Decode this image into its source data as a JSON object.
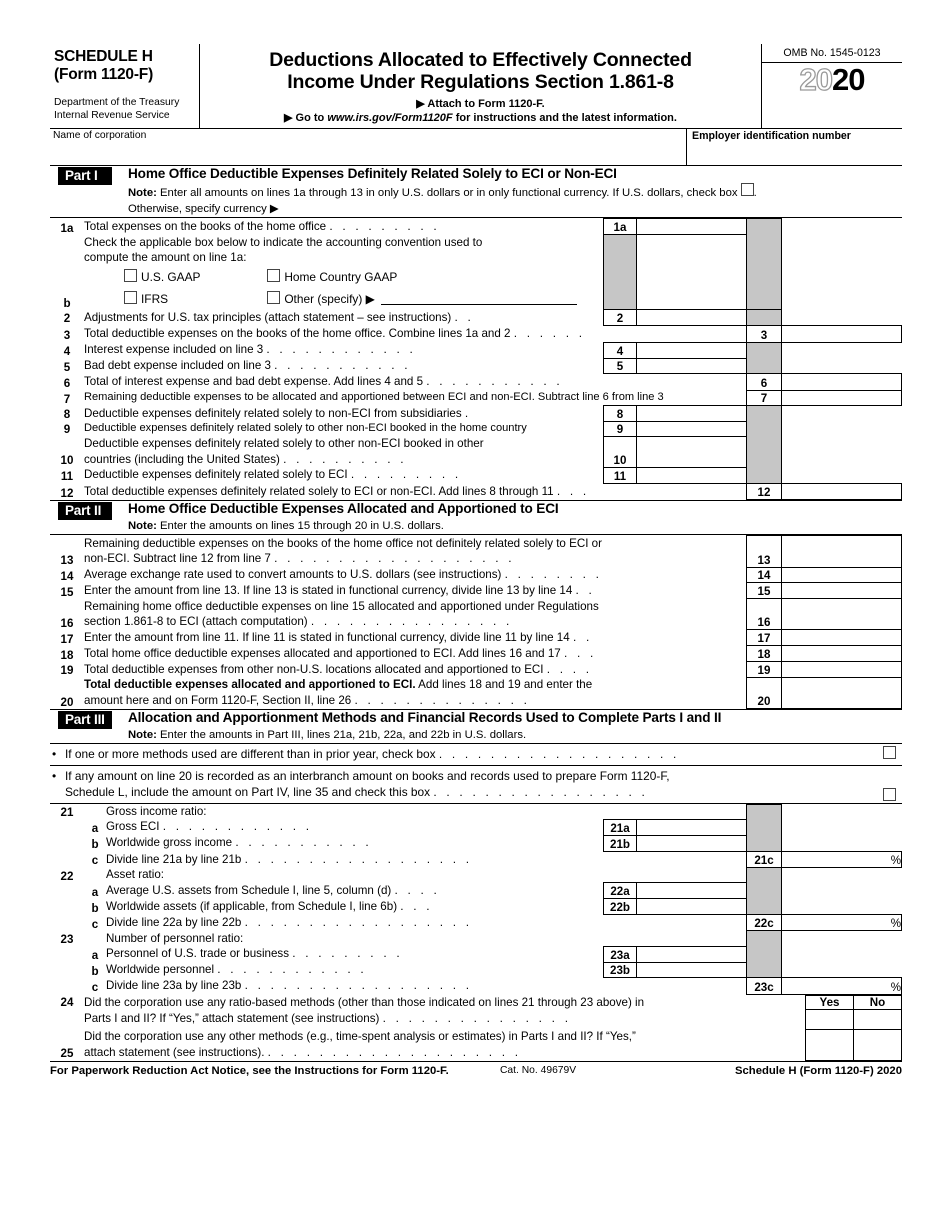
{
  "header": {
    "schedule_line1": "SCHEDULE H",
    "schedule_line2": "(Form 1120-F)",
    "dept_line1": "Department of the Treasury",
    "dept_line2": "Internal Revenue Service",
    "title_line1": "Deductions Allocated to Effectively Connected",
    "title_line2": "Income Under Regulations Section 1.861-8",
    "attach": "▶ Attach to Form 1120-F.",
    "goto_prefix": "▶ Go to ",
    "goto_url": "www.irs.gov/Form1120F",
    "goto_suffix": " for instructions and the latest information.",
    "omb": "OMB No. 1545-0123",
    "year_ghost": "20",
    "year_solid": "20"
  },
  "identity": {
    "name_label": "Name of corporation",
    "ein_label": "Employer identification number"
  },
  "part1": {
    "badge": "Part I",
    "heading": "Home Office Deductible Expenses Definitely Related Solely to ECI or Non-ECI",
    "note_bold": "Note:",
    "note_text": " Enter all amounts on lines 1a through 13 in only U.S. dollars or in only functional currency. If U.S. dollars, check box ",
    "note_tail": ".",
    "note_line2": "Otherwise, specify currency ▶",
    "rows": [
      {
        "num": "1a",
        "text": "Total expenses on the books of the home office",
        "dots": ". . . . . . . . .",
        "box": "1a",
        "col": "inner"
      },
      {
        "num": "b",
        "text": "Check the applicable box below to indicate the accounting convention used to",
        "text2": "compute the amount on line 1a:",
        "col": "none"
      },
      {
        "num": "2",
        "text": "Adjustments for U.S. tax principles (attach statement – see instructions)",
        "dots": ". .",
        "box": "2",
        "col": "inner"
      },
      {
        "num": "3",
        "text": "Total deductible expenses on the books of the home office. Combine lines 1a and 2",
        "dots": ". . . . . .",
        "box": "3",
        "col": "outer"
      },
      {
        "num": "4",
        "text": "Interest expense included on line 3",
        "dots": ". . . . . . . . . . . .",
        "box": "4",
        "col": "inner"
      },
      {
        "num": "5",
        "text": "Bad debt expense included on line 3",
        "dots": ". . . . . . . . . . .",
        "box": "5",
        "col": "inner"
      },
      {
        "num": "6",
        "text": "Total of interest expense and bad debt expense. Add lines 4 and 5",
        "dots": ". . . . . . . . . . .",
        "box": "6",
        "col": "outer"
      },
      {
        "num": "7",
        "text": "Remaining deductible expenses to be allocated and apportioned between ECI and non-ECI. Subtract line 6 from line 3",
        "dots": "",
        "box": "7",
        "col": "outer"
      },
      {
        "num": "8",
        "text": "Deductible expenses definitely related solely to non-ECI from subsidiaries",
        "dots": ".",
        "box": "8",
        "col": "inner"
      },
      {
        "num": "9",
        "text": "Deductible expenses definitely related solely to other non-ECI booked in the home country",
        "dots": "",
        "box": "9",
        "col": "inner"
      },
      {
        "num": "10",
        "text": "Deductible expenses definitely related solely to other non-ECI booked in other",
        "text2": "countries (including the United States)",
        "dots2": ". . . . . . . . . .",
        "box": "10",
        "col": "inner"
      },
      {
        "num": "11",
        "text": "Deductible expenses definitely related solely to ECI",
        "dots": ". . . . . . . . .",
        "box": "11",
        "col": "inner"
      },
      {
        "num": "12",
        "text": "Total deductible expenses definitely related solely to ECI or non-ECI. Add lines 8 through 11",
        "dots": ". . .",
        "box": "12",
        "col": "outer"
      }
    ],
    "accounting": {
      "opt1": "U.S. GAAP",
      "opt2": "Home Country GAAP",
      "opt3": "IFRS",
      "opt4": "Other (specify) ▶"
    }
  },
  "part2": {
    "badge": "Part II",
    "heading": "Home Office Deductible Expenses Allocated and Apportioned to ECI",
    "note_bold": "Note:",
    "note_text": " Enter the amounts on lines 15 through 20 in U.S. dollars.",
    "rows": [
      {
        "num": "13",
        "text": "Remaining deductible expenses on the books of the home office not definitely related solely to ECI or",
        "text2": "non-ECI. Subtract line 12 from line 7",
        "dots2": ". . . . . . . . . . . . . . . . . . .",
        "box": "13"
      },
      {
        "num": "14",
        "text": "Average exchange rate used to convert amounts to U.S. dollars (see instructions)",
        "dots": ". . . . . . . .",
        "box": "14"
      },
      {
        "num": "15",
        "text": "Enter the amount from line 13. If line 13 is stated in functional currency, divide line 13 by line 14",
        "dots": ". .",
        "box": "15"
      },
      {
        "num": "16",
        "text": "Remaining home office deductible expenses on line 15 allocated and apportioned under Regulations",
        "text2": "section 1.861-8 to ECI (attach computation)",
        "dots2": ". . . . . . . . . . . . . . . .",
        "box": "16"
      },
      {
        "num": "17",
        "text": "Enter the amount from line 11. If line 11 is stated in functional currency, divide line 11 by line 14",
        "dots": ". .",
        "box": "17"
      },
      {
        "num": "18",
        "text": "Total home office deductible expenses allocated and apportioned to ECI. Add lines 16 and 17",
        "dots": ". . .",
        "box": "18"
      },
      {
        "num": "19",
        "text": "Total deductible expenses from other non-U.S. locations allocated and apportioned to ECI",
        "dots": ". . . .",
        "box": "19"
      },
      {
        "num": "20",
        "text_bold": "Total deductible expenses allocated and apportioned to ECI.",
        "text": "  Add lines 18 and 19 and enter the",
        "text2": "amount here and on Form 1120-F, Section II, line 26",
        "dots2": ". . . . . . . . . . . . . .",
        "box": "20"
      }
    ]
  },
  "part3": {
    "badge": "Part III",
    "heading": "Allocation and Apportionment Methods and Financial Records Used to Complete Parts I and II",
    "note_bold": "Note:",
    "note_text": " Enter the amounts in Part III, lines 21a, 21b, 22a, and 22b in U.S. dollars.",
    "bullets": [
      {
        "text": "If one or more methods used are different than in prior year, check box",
        "dots": ". . . . . . . . . . . . . . . . . . ."
      },
      {
        "text": "If any amount on line 20 is recorded as an interbranch amount on books and records used to prepare Form 1120-F,",
        "text2": "Schedule L, include the amount on Part IV, line 35 and check this box",
        "dots2": ". . . . . . . . . . . . . . . . ."
      }
    ],
    "rows": [
      {
        "num": "21",
        "text": "Gross income ratio:",
        "col": "none"
      },
      {
        "num": "a",
        "text": "Gross ECI",
        "dots": ". . . . . . . . . . . .",
        "box": "21a",
        "col": "inner"
      },
      {
        "num": "b",
        "text": "Worldwide gross income",
        "dots": ". . . . . . . . . . .",
        "box": "21b",
        "col": "inner"
      },
      {
        "num": "c",
        "text": "Divide line 21a by line 21b",
        "dots": ". . . . . . . . . . . . . . . . . .",
        "box": "21c",
        "col": "outer",
        "pct": "%"
      },
      {
        "num": "22",
        "text": "Asset ratio:",
        "col": "none"
      },
      {
        "num": "a",
        "text": "Average U.S. assets from Schedule I, line 5, column (d)",
        "dots": ". . . .",
        "box": "22a",
        "col": "inner"
      },
      {
        "num": "b",
        "text": "Worldwide assets (if applicable, from Schedule I, line 6b)",
        "dots": ". . .",
        "box": "22b",
        "col": "inner"
      },
      {
        "num": "c",
        "text": "Divide line 22a by line 22b",
        "dots": ". . . . . . . . . . . . . . . . . .",
        "box": "22c",
        "col": "outer",
        "pct": "%"
      },
      {
        "num": "23",
        "text": "Number of personnel ratio:",
        "col": "none"
      },
      {
        "num": "a",
        "text": "Personnel of U.S. trade or business",
        "dots": ". . . . . . . . .",
        "box": "23a",
        "col": "inner"
      },
      {
        "num": "b",
        "text": "Worldwide personnel",
        "dots": ". . . . . . . . . . . .",
        "box": "23b",
        "col": "inner"
      },
      {
        "num": "c",
        "text": "Divide line 23a by line 23b",
        "dots": ". . . . . . . . . . . . . . . . . .",
        "box": "23c",
        "col": "outer",
        "pct": "%"
      }
    ],
    "yesno": {
      "yes": "Yes",
      "no": "No"
    },
    "questions": [
      {
        "num": "24",
        "text": "Did the corporation use any ratio-based methods (other than those indicated on lines 21 through 23 above) in",
        "text2": "Parts I and II? If “Yes,” attach statement (see instructions)",
        "dots2": ". . . . . . . . . . . . . . ."
      },
      {
        "num": "25",
        "text": "Did the corporation use any other methods (e.g., time-spent analysis or estimates) in Parts I and II? If “Yes,”",
        "text2": "attach statement (see instructions).",
        "dots2": ". . . . . . . . . . . . . . . . . . . ."
      }
    ]
  },
  "footer": {
    "left": "For Paperwork Reduction Act Notice, see the Instructions for Form 1120-F.",
    "cat": "Cat. No. 49679V",
    "right": "Schedule H (Form 1120-F) 2020"
  },
  "colors": {
    "shade": "#c6c6c6",
    "ink": "#000000",
    "paper": "#ffffff"
  }
}
